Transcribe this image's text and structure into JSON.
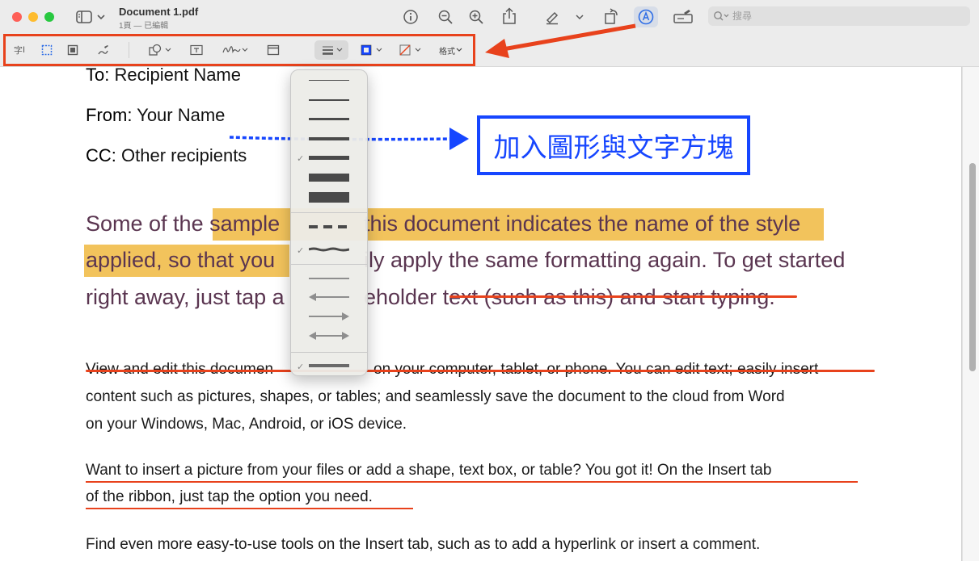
{
  "window": {
    "doc_title": "Document 1.pdf",
    "doc_subtitle": "1頁 — 已編輯",
    "search_placeholder": "搜尋"
  },
  "markup_toolbar": {
    "text_selection_label": "字",
    "format_label": "格式"
  },
  "callout": {
    "text": "加入圖形與文字方塊"
  },
  "document": {
    "to_label": "To:",
    "to_value": "Recipient Name",
    "from_label": "From:",
    "from_value": "Your Name",
    "cc_label": "CC:",
    "cc_value": "Other recipients",
    "body_line1_a": "Some of the ",
    "body_line1_b": "sample",
    "body_line1_c": "this document indicates the name of the style",
    "body_line2_a": "applied, so that you",
    "body_line2_b": "ily apply the same formatting again. To get started",
    "body_line3_a": "right away, just tap a",
    "body_line3_b": "eholder ",
    "body_line3_c": "text (such as this) and start typing.",
    "para1_line1_a": "View and edit this documen",
    "para1_line1_b": "on your computer, tablet, or phone. You can edit text; easily insert",
    "para1_line2": "content such as pictures, shapes, or tables; and seamlessly save the document to the cloud from Word",
    "para1_line3": "on your Windows, Mac, Android, or iOS device.",
    "para2_line1": "Want to insert a picture from your files or add a shape, text box, or table? You got it! On the Insert tab",
    "para2_line2": "of the ribbon, just tap the option you need.",
    "para3_line1": "Find even more easy-to-use tools on the Insert tab, such as to add a hyperlink or insert a comment."
  },
  "colors": {
    "annotation_red": "#e8421c",
    "annotation_blue": "#1646ff",
    "highlight_yellow": "#f2c35c",
    "body_purple": "#5a3550"
  }
}
